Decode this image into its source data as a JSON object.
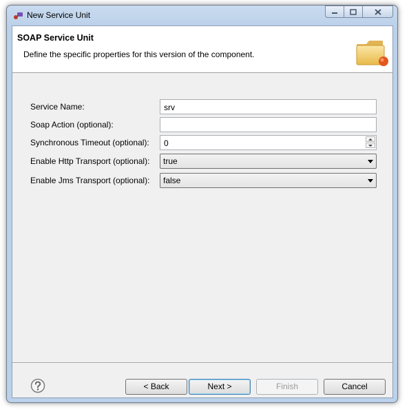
{
  "window": {
    "title": "New Service Unit"
  },
  "header": {
    "title": "SOAP Service Unit",
    "description": "Define the specific properties for this version of the component."
  },
  "form": {
    "service_name": {
      "label": "Service Name:",
      "value": "srv"
    },
    "soap_action": {
      "label": "Soap Action (optional):",
      "value": ""
    },
    "sync_timeout": {
      "label": "Synchronous Timeout (optional):",
      "value": "0"
    },
    "http_transport": {
      "label": "Enable Http Transport (optional):",
      "value": "true"
    },
    "jms_transport": {
      "label": "Enable Jms Transport (optional):",
      "value": "false"
    }
  },
  "buttons": {
    "back": "< Back",
    "next": "Next >",
    "finish": "Finish",
    "cancel": "Cancel"
  },
  "icons": {
    "app": "eclipse-wizard-icon",
    "banner": "folder-icon",
    "help": "help-icon"
  }
}
